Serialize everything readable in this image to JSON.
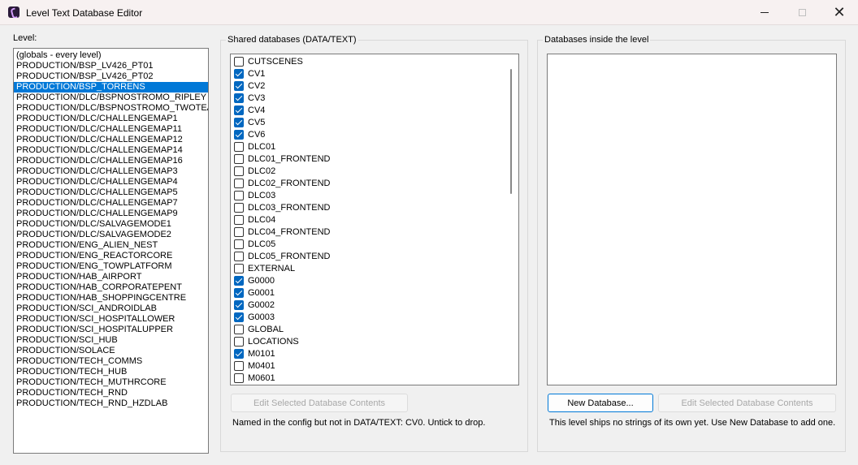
{
  "window": {
    "title": "Level Text Database Editor"
  },
  "level_panel": {
    "label": "Level:",
    "items": [
      "(globals - every level)",
      "PRODUCTION/BSP_LV426_PT01",
      "PRODUCTION/BSP_LV426_PT02",
      "PRODUCTION/BSP_TORRENS",
      "PRODUCTION/DLC/BSPNOSTROMO_RIPLEY",
      "PRODUCTION/DLC/BSPNOSTROMO_TWOTEA",
      "PRODUCTION/DLC/CHALLENGEMAP1",
      "PRODUCTION/DLC/CHALLENGEMAP11",
      "PRODUCTION/DLC/CHALLENGEMAP12",
      "PRODUCTION/DLC/CHALLENGEMAP14",
      "PRODUCTION/DLC/CHALLENGEMAP16",
      "PRODUCTION/DLC/CHALLENGEMAP3",
      "PRODUCTION/DLC/CHALLENGEMAP4",
      "PRODUCTION/DLC/CHALLENGEMAP5",
      "PRODUCTION/DLC/CHALLENGEMAP7",
      "PRODUCTION/DLC/CHALLENGEMAP9",
      "PRODUCTION/DLC/SALVAGEMODE1",
      "PRODUCTION/DLC/SALVAGEMODE2",
      "PRODUCTION/ENG_ALIEN_NEST",
      "PRODUCTION/ENG_REACTORCORE",
      "PRODUCTION/ENG_TOWPLATFORM",
      "PRODUCTION/HAB_AIRPORT",
      "PRODUCTION/HAB_CORPORATEPENT",
      "PRODUCTION/HAB_SHOPPINGCENTRE",
      "PRODUCTION/SCI_ANDROIDLAB",
      "PRODUCTION/SCI_HOSPITALLOWER",
      "PRODUCTION/SCI_HOSPITALUPPER",
      "PRODUCTION/SCI_HUB",
      "PRODUCTION/SOLACE",
      "PRODUCTION/TECH_COMMS",
      "PRODUCTION/TECH_HUB",
      "PRODUCTION/TECH_MUTHRCORE",
      "PRODUCTION/TECH_RND",
      "PRODUCTION/TECH_RND_HZDLAB"
    ],
    "selected_index": 3
  },
  "shared_panel": {
    "title": "Shared databases (DATA/TEXT)",
    "items": [
      {
        "label": "CUTSCENES",
        "checked": false
      },
      {
        "label": "CV1",
        "checked": true
      },
      {
        "label": "CV2",
        "checked": true
      },
      {
        "label": "CV3",
        "checked": true
      },
      {
        "label": "CV4",
        "checked": true
      },
      {
        "label": "CV5",
        "checked": true
      },
      {
        "label": "CV6",
        "checked": true
      },
      {
        "label": "DLC01",
        "checked": false
      },
      {
        "label": "DLC01_FRONTEND",
        "checked": false
      },
      {
        "label": "DLC02",
        "checked": false
      },
      {
        "label": "DLC02_FRONTEND",
        "checked": false
      },
      {
        "label": "DLC03",
        "checked": false
      },
      {
        "label": "DLC03_FRONTEND",
        "checked": false
      },
      {
        "label": "DLC04",
        "checked": false
      },
      {
        "label": "DLC04_FRONTEND",
        "checked": false
      },
      {
        "label": "DLC05",
        "checked": false
      },
      {
        "label": "DLC05_FRONTEND",
        "checked": false
      },
      {
        "label": "EXTERNAL",
        "checked": false
      },
      {
        "label": "G0000",
        "checked": true
      },
      {
        "label": "G0001",
        "checked": true
      },
      {
        "label": "G0002",
        "checked": true
      },
      {
        "label": "G0003",
        "checked": true
      },
      {
        "label": "GLOBAL",
        "checked": false
      },
      {
        "label": "LOCATIONS",
        "checked": false
      },
      {
        "label": "M0101",
        "checked": true
      },
      {
        "label": "M0401",
        "checked": false
      },
      {
        "label": "M0601",
        "checked": false
      }
    ],
    "edit_button": "Edit Selected Database Contents",
    "note": "Named in the config but not in DATA/TEXT: CV0. Untick to drop."
  },
  "level_db_panel": {
    "title": "Databases inside the level",
    "new_button": "New Database...",
    "edit_button": "Edit Selected Database Contents",
    "note": "This level ships no strings of its own yet. Use New Database to add one."
  },
  "colors": {
    "selection": "#0078d7",
    "checkbox_checked": "#0067c0"
  }
}
